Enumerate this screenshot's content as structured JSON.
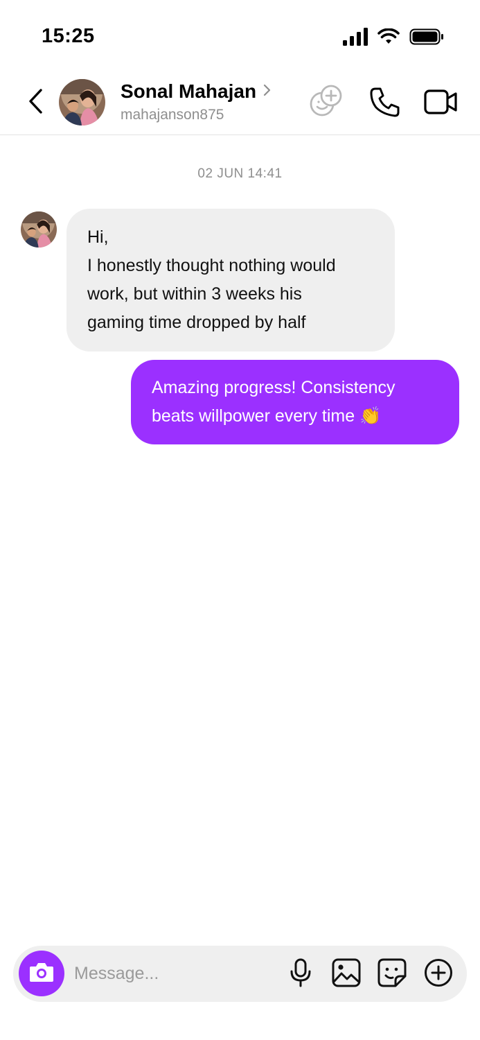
{
  "status_bar": {
    "time": "15:25",
    "icons": [
      "signal-icon",
      "wifi-icon",
      "battery-icon"
    ]
  },
  "header": {
    "name": "Sonal Mahajan",
    "username": "mahajanson875",
    "chevron": "›",
    "icons": [
      "back-arrow-icon",
      "add-reaction-icon",
      "phone-icon",
      "video-camera-icon"
    ]
  },
  "conversation": {
    "timestamp": "02 JUN 14:41",
    "messages": [
      {
        "direction": "incoming",
        "lines": [
          "Hi,",
          "I honestly thought nothing would",
          "work, but within 3 weeks his",
          "gaming time dropped by half"
        ]
      },
      {
        "direction": "outgoing",
        "text": "Amazing progress! Consistency beats willpower every time 👏"
      }
    ]
  },
  "composer": {
    "placeholder": "Message...",
    "icons": [
      "camera-icon",
      "microphone-icon",
      "gallery-icon",
      "sticker-icon",
      "plus-circle-icon"
    ]
  },
  "colors": {
    "accent": "#9b30ff",
    "incoming_bubble": "#efefef",
    "muted_text": "#8e8e8e"
  }
}
